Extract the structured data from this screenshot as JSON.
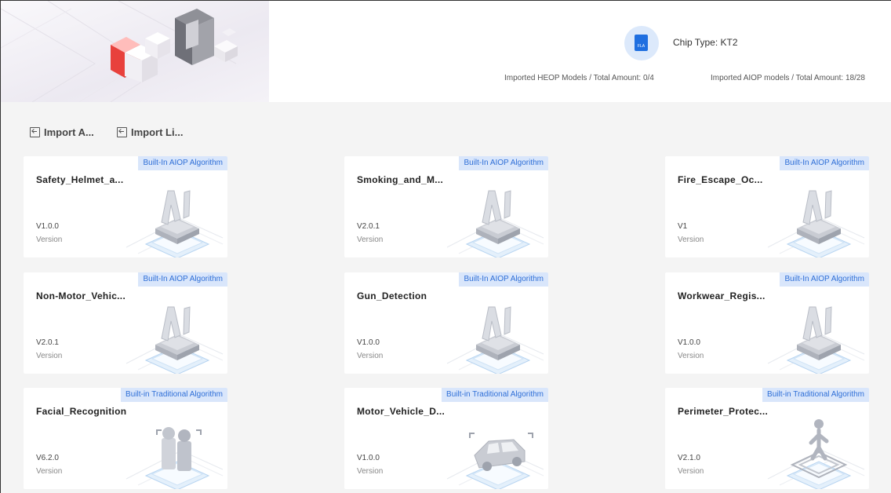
{
  "header": {
    "chip_icon_label": "FLA",
    "chip_type": "Chip Type: KT2",
    "heop_stat": "Imported HEOP Models / Total Amount: 0/4",
    "aiop_stat": "Imported AIOP models / Total Amount: 18/28"
  },
  "toolbar": {
    "import_algorithm": "Import A...",
    "import_license": "Import Li..."
  },
  "cards": [
    {
      "name": "Safety_Helmet_a...",
      "tag": "Built-In AIOP Algorithm",
      "version": "V1.0.0",
      "version_label": "Version",
      "icon": "ai-chip-icon"
    },
    {
      "name": "Smoking_and_M...",
      "tag": "Built-In AIOP Algorithm",
      "version": "V2.0.1",
      "version_label": "Version",
      "icon": "ai-chip-icon"
    },
    {
      "name": "Fire_Escape_Oc...",
      "tag": "Built-In AIOP Algorithm",
      "version": "V1",
      "version_label": "Version",
      "icon": "ai-chip-icon"
    },
    {
      "name": "Non-Motor_Vehic...",
      "tag": "Built-In AIOP Algorithm",
      "version": "V2.0.1",
      "version_label": "Version",
      "icon": "ai-chip-icon"
    },
    {
      "name": "Gun_Detection",
      "tag": "Built-In AIOP Algorithm",
      "version": "V1.0.0",
      "version_label": "Version",
      "icon": "ai-chip-icon"
    },
    {
      "name": "Workwear_Regis...",
      "tag": "Built-In AIOP Algorithm",
      "version": "V1.0.0",
      "version_label": "Version",
      "icon": "ai-chip-icon"
    },
    {
      "name": "Facial_Recognition",
      "tag": "Built-in Traditional Algorithm",
      "version": "V6.2.0",
      "version_label": "Version",
      "icon": "face-recognition-icon"
    },
    {
      "name": "Motor_Vehicle_D...",
      "tag": "Built-in Traditional Algorithm",
      "version": "V1.0.0",
      "version_label": "Version",
      "icon": "vehicle-icon"
    },
    {
      "name": "Perimeter_Protec...",
      "tag": "Built-in Traditional Algorithm",
      "version": "V2.1.0",
      "version_label": "Version",
      "icon": "perimeter-person-icon"
    }
  ],
  "colors": {
    "accent": "#2f6fd7",
    "tag_bg": "#d9e6fb",
    "banner_red": "#e8413c"
  }
}
